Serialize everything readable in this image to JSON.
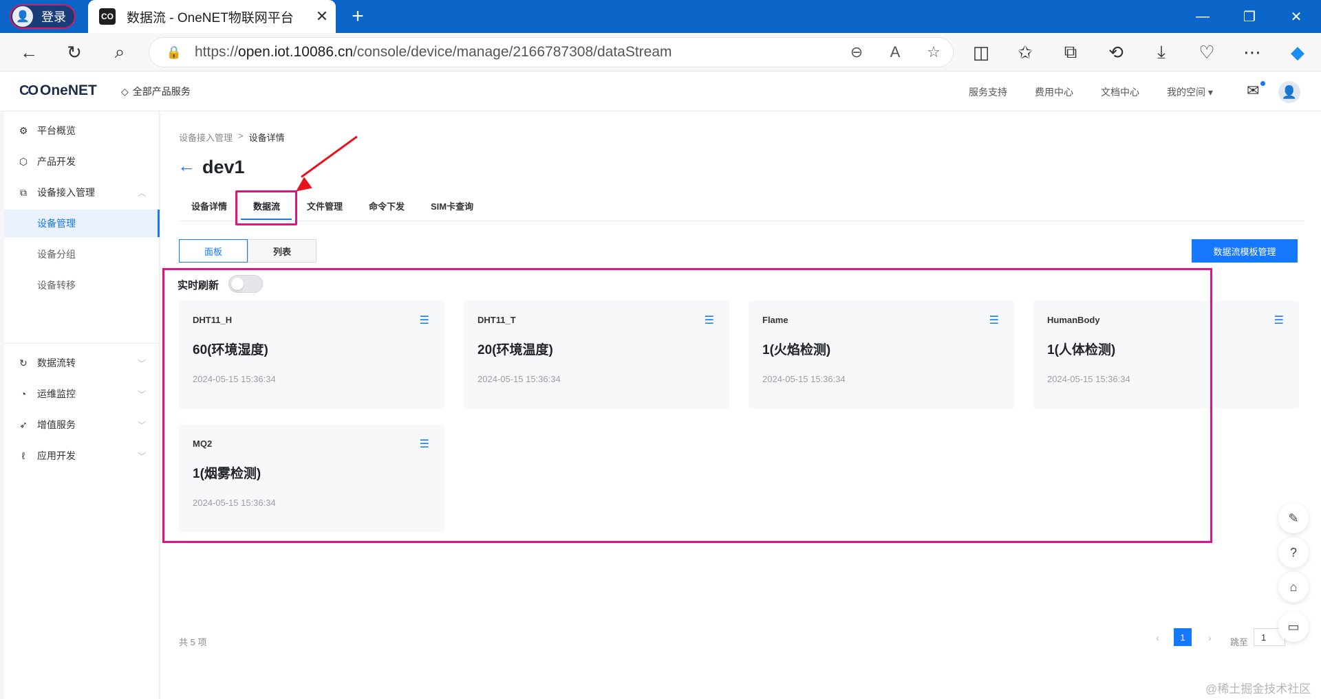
{
  "browser": {
    "profile_label": "登录",
    "tab_title": "数据流 - OneNET物联网平台",
    "tab_favicon": "CO",
    "new_tab": "+",
    "url_scheme": "https://",
    "url_host": "open.iot.10086.cn",
    "url_path": "/console/device/manage/2166787308/dataStream"
  },
  "header": {
    "logo": "OneNET",
    "logo_mark": "CO",
    "all_products": "全部产品服务",
    "links": [
      "服务支持",
      "费用中心",
      "文档中心",
      "我的空间"
    ]
  },
  "sidebar": {
    "items": [
      {
        "label": "平台概览",
        "icon": "dashboard-icon"
      },
      {
        "label": "产品开发",
        "icon": "cube-icon"
      },
      {
        "label": "设备接入管理",
        "icon": "device-icon"
      }
    ],
    "subitems": [
      "设备管理",
      "设备分组",
      "设备转移"
    ],
    "items2": [
      {
        "label": "数据流转",
        "icon": "flow-icon"
      },
      {
        "label": "运维监控",
        "icon": "monitor-icon"
      },
      {
        "label": "增值服务",
        "icon": "send-icon"
      },
      {
        "label": "应用开发",
        "icon": "app-icon"
      }
    ]
  },
  "main": {
    "breadcrumb": [
      "设备接入管理",
      "设备详情"
    ],
    "breadcrumb_sep": ">",
    "device_name": "dev1",
    "tabs": [
      "设备详情",
      "数据流",
      "文件管理",
      "命令下发",
      "SIM卡查询"
    ],
    "active_tab": "数据流",
    "view_modes": [
      "面板",
      "列表"
    ],
    "template_button": "数据流模板管理",
    "realtime_label": "实时刷新",
    "realtime_on": false,
    "streams": [
      {
        "name": "DHT11_H",
        "value": "60(环境湿度)",
        "time": "2024-05-15 15:36:34"
      },
      {
        "name": "DHT11_T",
        "value": "20(环境温度)",
        "time": "2024-05-15 15:36:34"
      },
      {
        "name": "Flame",
        "value": "1(火焰检测)",
        "time": "2024-05-15 15:36:34"
      },
      {
        "name": "HumanBody",
        "value": "1(人体检测)",
        "time": "2024-05-15 15:36:34"
      },
      {
        "name": "MQ2",
        "value": "1(烟雾检测)",
        "time": "2024-05-15 15:36:34"
      }
    ],
    "total": "共 5 项",
    "page_current": "1",
    "jump_label": "跳至",
    "jump_value": "1"
  },
  "watermark": "@稀土掘金技术社区",
  "colors": {
    "accent": "#1677ff",
    "highlight": "#e0147f",
    "arrow": "#e8121c",
    "chrome": "#0b64c8"
  }
}
